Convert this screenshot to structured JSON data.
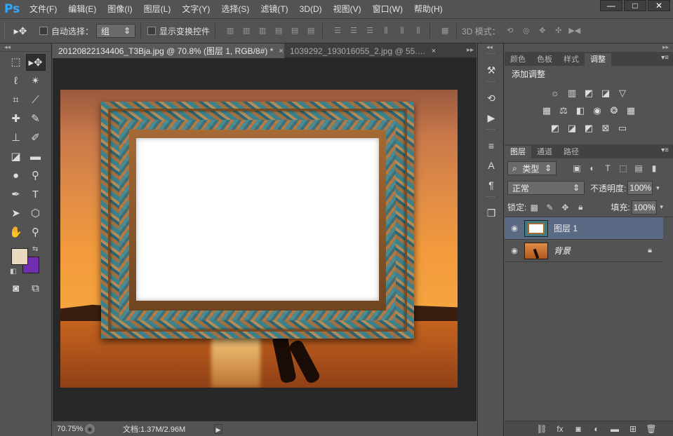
{
  "app": {
    "logo": "Ps"
  },
  "menu": [
    "文件(F)",
    "编辑(E)",
    "图像(I)",
    "图层(L)",
    "文字(Y)",
    "选择(S)",
    "滤镜(T)",
    "3D(D)",
    "视图(V)",
    "窗口(W)",
    "帮助(H)"
  ],
  "window_controls": {
    "minimize": "—",
    "maximize": "□",
    "close": "✕"
  },
  "options_bar": {
    "auto_select_label": "自动选择：",
    "auto_select_value": "组",
    "show_transform_label": "显示变换控件",
    "mode_3d_label": "3D 模式："
  },
  "doc_tabs": [
    {
      "title": "20120822134406_T3Bja.jpg @ 70.8% (图层 1, RGB/8#) *",
      "close": "×"
    },
    {
      "title": "1039292_193016055_2.jpg @ 55.…",
      "close": "×"
    }
  ],
  "status": {
    "zoom": "70.75%",
    "doc": "文档:1.37M/2.96M"
  },
  "colors": {
    "foreground": "#e8d8c0",
    "background": "#6f2fb0",
    "accent_select": "#5a6a84"
  },
  "panels": {
    "top_tabs": [
      "颜色",
      "色板",
      "样式",
      "调整"
    ],
    "adjust_title": "添加调整",
    "layer_tabs": [
      "图层",
      "通道",
      "路径"
    ],
    "filter_type": "类型",
    "blend_mode": "正常",
    "opacity_label": "不透明度:",
    "opacity_value": "100%",
    "lock_label": "锁定:",
    "fill_label": "填充:",
    "fill_value": "100%"
  },
  "layers": [
    {
      "name": "图层 1",
      "selected": true
    },
    {
      "name": "背景",
      "locked": true
    }
  ],
  "icons": {
    "tools": [
      "marquee-icon",
      "move-icon",
      "lasso-icon",
      "magic-wand-icon",
      "crop-icon",
      "eyedropper-icon",
      "healing-icon",
      "brush-icon",
      "stamp-icon",
      "history-brush-icon",
      "eraser-icon",
      "gradient-icon",
      "blur-icon",
      "dodge-icon",
      "pen-icon",
      "type-icon",
      "path-select-icon",
      "shape-icon",
      "hand-icon",
      "zoom-icon"
    ]
  }
}
